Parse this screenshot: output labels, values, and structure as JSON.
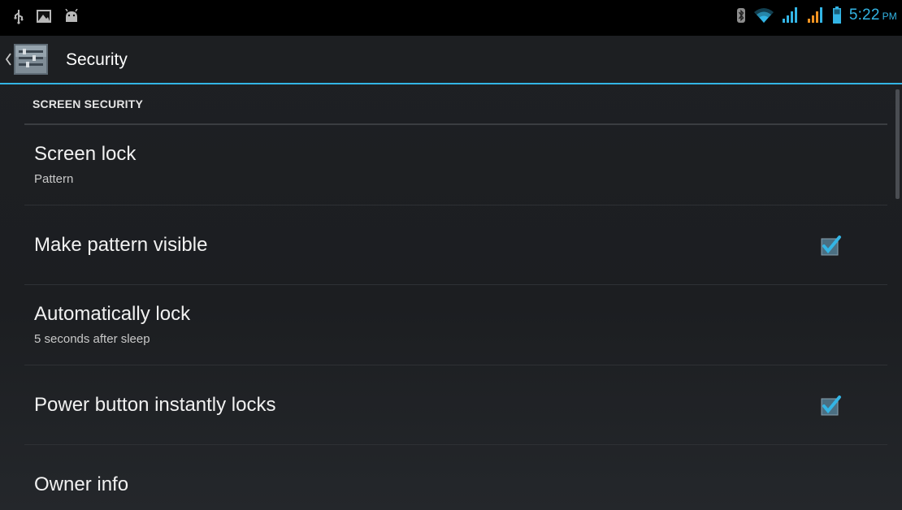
{
  "status_bar": {
    "left_icons": [
      "usb-icon",
      "image-notification-icon",
      "android-debug-icon"
    ],
    "right_icons": [
      "bluetooth-icon",
      "wifi-icon",
      "signal-icon",
      "signal-icon-2",
      "battery-icon"
    ],
    "time": "5:22",
    "ampm": "PM",
    "accent_color": "#33b5e5"
  },
  "action_bar": {
    "title": "Security",
    "up_icon": "chevron-left-icon",
    "app_icon": "settings-app-icon"
  },
  "list": {
    "section_header": "SCREEN SECURITY",
    "items": [
      {
        "title": "Screen lock",
        "summary": "Pattern"
      },
      {
        "title": "Make pattern visible",
        "checked": true
      },
      {
        "title": "Automatically lock",
        "summary": "5 seconds after sleep"
      },
      {
        "title": "Power button instantly locks",
        "checked": true
      },
      {
        "title": "Owner info"
      }
    ]
  }
}
